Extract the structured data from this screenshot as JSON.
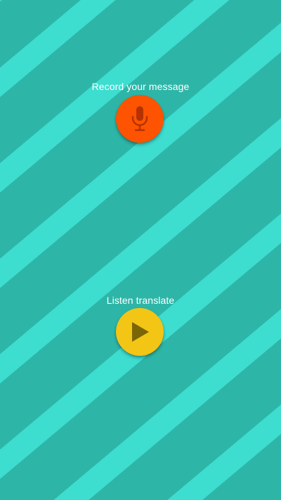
{
  "colors": {
    "stripe_dark": "#2db6a8",
    "stripe_light": "#3dddd0",
    "record_button": "#fe5300",
    "record_icon": "#b53200",
    "play_button": "#f3c514",
    "play_icon": "#7a6606",
    "label_text": "#ffffff"
  },
  "record": {
    "label": "Record your message",
    "icon": "microphone-icon"
  },
  "listen": {
    "label": "Listen translate",
    "icon": "play-icon"
  }
}
